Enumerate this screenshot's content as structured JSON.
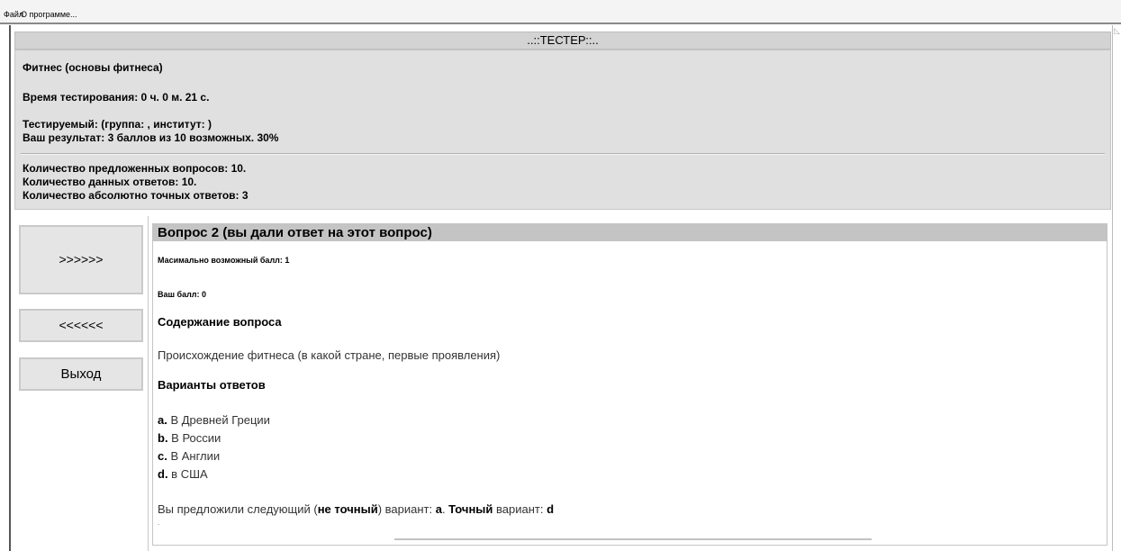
{
  "menu": {
    "file": "Файл",
    "about": "О программе..."
  },
  "window_title": "..::ТЕСТЕР::..",
  "info": {
    "course": "Фитнес (основы фитнеса)",
    "time": "Время тестирования: 0 ч. 0 м. 21 с.",
    "tested": "Тестируемый:   (группа: , институт: )",
    "result": "Ваш результат: 3 баллов из 10 возможных. 30%",
    "asked": "Количество предложенных вопросов: 10.",
    "answered": "Количество данных ответов: 10.",
    "exact": "Количество абсолютно точных ответов: 3"
  },
  "nav": {
    "next": ">>>>>>",
    "prev": "<<<<<<",
    "exit": "Выход"
  },
  "question": {
    "header": "Вопрос 2 (вы дали ответ на этот вопрос)",
    "max_score": "Масимально возможный балл: 1",
    "your_score": "Ваш балл: 0",
    "content_heading": "Содержание вопроса",
    "content": "Происхождение фитнеса (в какой стране, первые проявления)",
    "options_heading": "Варианты ответов",
    "options": [
      {
        "letter": "a.",
        "text": " В Древней Греции"
      },
      {
        "letter": "b.",
        "text": " В России"
      },
      {
        "letter": "c.",
        "text": " В Англии"
      },
      {
        "letter": "d.",
        "text": " в США"
      }
    ],
    "result": {
      "prefix": "Вы предложили следующий (",
      "not_exact": "не точный",
      "middle": ") вариант: ",
      "chosen": "а",
      "dot": ". ",
      "exact_label": "Точный",
      "exact_middle": " вариант: ",
      "exact": "d"
    },
    "trailing": "."
  }
}
